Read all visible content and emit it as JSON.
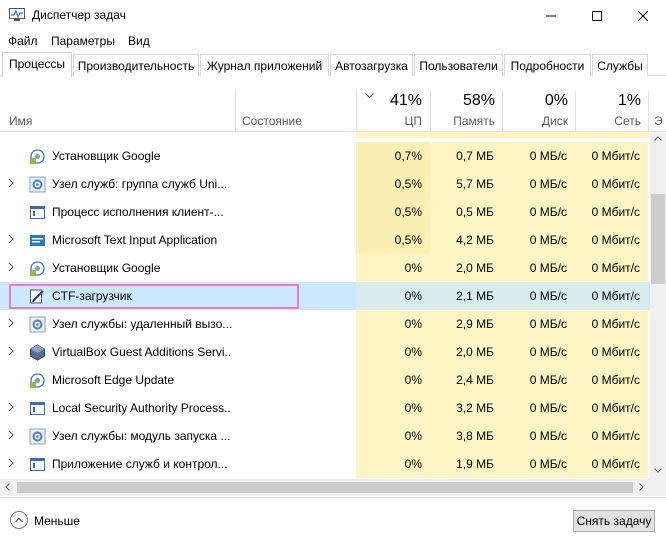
{
  "window": {
    "title": "Диспетчер задач",
    "app_icon": "task-manager-icon"
  },
  "menu": [
    "Файл",
    "Параметры",
    "Вид"
  ],
  "tabs": [
    "Процессы",
    "Производительность",
    "Журнал приложений",
    "Автозагрузка",
    "Пользователи",
    "Подробности",
    "Службы"
  ],
  "active_tab": "Процессы",
  "columns": {
    "name": "Имя",
    "state": "Состояние",
    "cpu": {
      "pct": "41%",
      "label": "ЦП"
    },
    "memory": {
      "pct": "58%",
      "label": "Память"
    },
    "disk": {
      "pct": "0%",
      "label": "Диск"
    },
    "network": {
      "pct": "1%",
      "label": "Сеть"
    },
    "extra": "Э"
  },
  "processes": [
    {
      "name": "Установщик Google",
      "icon": "google-installer-icon",
      "expandable": false,
      "cpu": "0,7%",
      "mem": "0,7 МБ",
      "disk": "0 МБ/с",
      "net": "0 Мбит/с"
    },
    {
      "name": "Узел служб: группа служб Uni...",
      "icon": "service-host-gear-icon",
      "expandable": true,
      "cpu": "0,5%",
      "mem": "5,7 МБ",
      "disk": "0 МБ/с",
      "net": "0 Мбит/с"
    },
    {
      "name": "Процесс исполнения клиент-...",
      "icon": "window-app-icon",
      "expandable": false,
      "cpu": "0,5%",
      "mem": "0,5 МБ",
      "disk": "0 МБ/с",
      "net": "0 Мбит/с"
    },
    {
      "name": "Microsoft Text Input Application",
      "icon": "text-input-app-icon",
      "expandable": true,
      "cpu": "0,5%",
      "mem": "4,2 МБ",
      "disk": "0 МБ/с",
      "net": "0 Мбит/с"
    },
    {
      "name": "Установщик Google",
      "icon": "google-installer-icon",
      "expandable": true,
      "cpu": "0%",
      "mem": "2,0 МБ",
      "disk": "0 МБ/с",
      "net": "0 Мбит/с"
    },
    {
      "name": "CTF-загрузчик",
      "icon": "ctf-loader-pen-icon",
      "expandable": false,
      "selected": true,
      "cpu": "0%",
      "mem": "2,1 МБ",
      "disk": "0 МБ/с",
      "net": "0 Мбит/с"
    },
    {
      "name": "Узел службы: удаленный вызо...",
      "icon": "service-host-gear-icon",
      "expandable": true,
      "cpu": "0%",
      "mem": "2,9 МБ",
      "disk": "0 МБ/с",
      "net": "0 Мбит/с"
    },
    {
      "name": "VirtualBox Guest Additions Servi...",
      "icon": "virtualbox-icon",
      "expandable": true,
      "cpu": "0%",
      "mem": "2,0 МБ",
      "disk": "0 МБ/с",
      "net": "0 Мбит/с"
    },
    {
      "name": "Microsoft Edge Update",
      "icon": "edge-update-icon",
      "expandable": false,
      "cpu": "0%",
      "mem": "2,4 МБ",
      "disk": "0 МБ/с",
      "net": "0 Мбит/с"
    },
    {
      "name": "Local Security Authority Process...",
      "icon": "window-app-icon",
      "expandable": true,
      "cpu": "0%",
      "mem": "3,2 МБ",
      "disk": "0 МБ/с",
      "net": "0 Мбит/с"
    },
    {
      "name": "Узел службы: модуль запуска ...",
      "icon": "service-host-gear-icon",
      "expandable": true,
      "cpu": "0%",
      "mem": "3,8 МБ",
      "disk": "0 МБ/с",
      "net": "0 Мбит/с"
    },
    {
      "name": "Приложение служб и контрол...",
      "icon": "window-app-icon",
      "expandable": true,
      "cpu": "0%",
      "mem": "1,9 МБ",
      "disk": "0 МБ/с",
      "net": "0 Мбит/с"
    }
  ],
  "footer": {
    "less_label": "Меньше",
    "end_task_label": "Снять задачу"
  },
  "colors": {
    "cpu_heat_high": "#fff4c4",
    "cpu_heat_mid": "#fcefb4",
    "col_heat": "#fff4c4",
    "selected_row": "#cce8ff",
    "selected_heat": "#d8ecec",
    "highlight_outline": "#e87ec8"
  }
}
